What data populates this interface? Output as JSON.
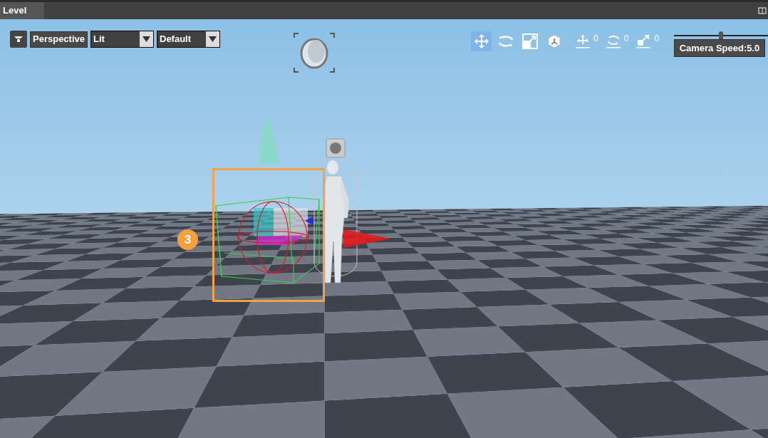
{
  "panel": {
    "tab": "Level"
  },
  "toolbar": {
    "view_mode": "Perspective",
    "dropdowns": [
      {
        "value": "Lit"
      },
      {
        "value": "Default"
      }
    ]
  },
  "transform_tools": [
    {
      "kind": "move",
      "selected": true
    },
    {
      "kind": "rotate",
      "selected": false
    },
    {
      "kind": "scale",
      "selected": false
    }
  ],
  "local_space": {
    "on": true
  },
  "snaps": [
    {
      "kind": "move",
      "value": "0"
    },
    {
      "kind": "rotate",
      "value": "0"
    },
    {
      "kind": "scale",
      "value": "0"
    }
  ],
  "camera_speed": {
    "level": 0.5,
    "label": "Camera Speed:5.0"
  },
  "annotation": {
    "badge": "3"
  }
}
